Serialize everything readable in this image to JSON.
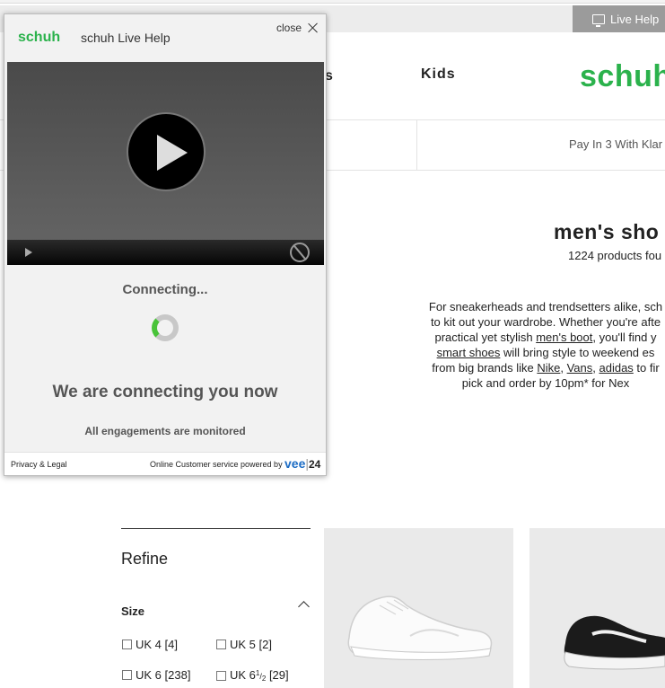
{
  "site": {
    "live_help_label": "Live Help",
    "nav_partial": "s",
    "nav_kids": "Kids",
    "logo": "schuh",
    "promo": "Pay In 3 With Klar",
    "page_title": "men's sho",
    "count": "1224 products fou",
    "intro": {
      "line1": "For sneakerheads and trendsetters alike, sch",
      "line2": "to kit out your wardrobe. Whether you're afte",
      "line3_pre": "practical yet stylish ",
      "line3_link": "men's boot",
      "line3_post": ", you'll find y",
      "line4_link": "smart shoes",
      "line4_post": " will bring style to weekend es",
      "line5_pre": "from big brands like ",
      "line5_link1": "Nike",
      "line5_sep1": ", ",
      "line5_link2": "Vans",
      "line5_sep2": ", ",
      "line5_link3": "adidas",
      "line5_post": " to fir",
      "line6": "pick and order by 10pm* for Nex"
    },
    "refine_title": "Refine",
    "size_title": "Size",
    "sizes": [
      {
        "label": "UK 4 [4]"
      },
      {
        "label": "UK 5 [2]"
      },
      {
        "label": "UK 6 [238]"
      },
      {
        "label_pre": "UK 6",
        "frac_num": "1",
        "frac_den": "2",
        "label_post": " [29]"
      }
    ]
  },
  "chat": {
    "logo": "schuh",
    "title": "schuh Live Help",
    "close_label": "close",
    "status_small": "Connecting...",
    "status_big": "We are connecting you now",
    "monitored": "All engagements are monitored",
    "privacy": "Privacy & Legal",
    "powered_by": "Online Customer service powered by",
    "vendor_vee": "vee",
    "vendor_sep": "|",
    "vendor_24": "24"
  },
  "colors": {
    "brand_green": "#2bb24c",
    "spinner_green": "#49c339",
    "vee_blue": "#1c6cc4"
  }
}
